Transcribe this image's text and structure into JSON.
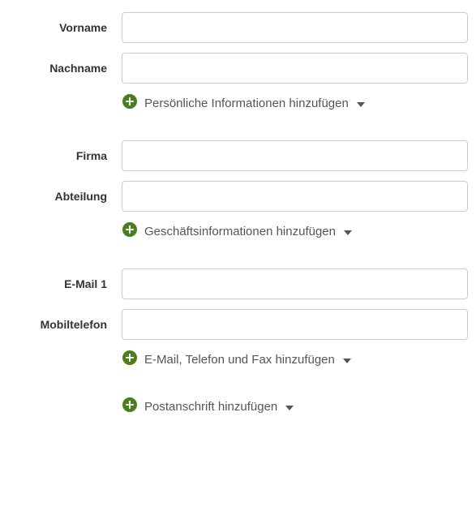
{
  "sections": {
    "personal": {
      "fields": {
        "vorname_label": "Vorname",
        "nachname_label": "Nachname"
      },
      "add_link": "Persönliche Informationen hinzufügen"
    },
    "business": {
      "fields": {
        "firma_label": "Firma",
        "abteilung_label": "Abteilung"
      },
      "add_link": "Geschäftsinformationen hinzufügen"
    },
    "contact": {
      "fields": {
        "email1_label": "E-Mail 1",
        "mobile_label": "Mobiltelefon"
      },
      "add_link": "E-Mail, Telefon und Fax hinzufügen"
    },
    "address": {
      "add_link": "Postanschrift hinzufügen"
    }
  },
  "colors": {
    "icon_green": "#4a7e1e"
  }
}
